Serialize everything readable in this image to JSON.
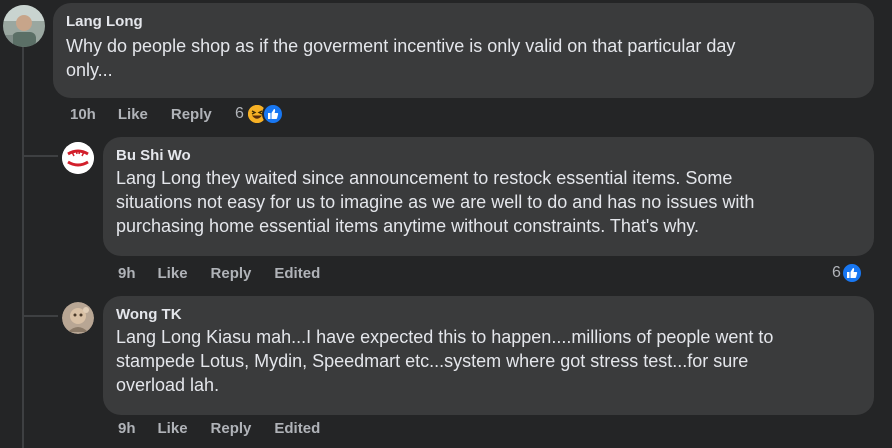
{
  "comments": [
    {
      "author": "Lang Long",
      "text_lines": [
        "Why do people shop as if the goverment incentive is only valid on that particular day",
        "only..."
      ],
      "time": "10h",
      "like_label": "Like",
      "reply_label": "Reply",
      "reaction_count": "6",
      "reactions": [
        "haha-icon",
        "like-icon"
      ]
    },
    {
      "author": "Bu Shi Wo",
      "text_lines": [
        "Lang Long they waited since announcement to restock essential items. Some",
        "situations not easy for us to imagine as we are well to do and has no issues with",
        "purchasing home essential items anytime without constraints. That's why."
      ],
      "time": "9h",
      "like_label": "Like",
      "reply_label": "Reply",
      "edited_label": "Edited",
      "reaction_count": "6",
      "reactions": [
        "like-icon"
      ]
    },
    {
      "author": "Wong TK",
      "text_lines": [
        "Lang Long Kiasu mah...I have expected this to happen....millions of people went to",
        "stampede Lotus, Mydin, Speedmart etc...system where got stress test...for sure",
        "overload lah."
      ],
      "time": "9h",
      "like_label": "Like",
      "reply_label": "Reply",
      "edited_label": "Edited"
    }
  ],
  "colors": {
    "background": "#242526",
    "bubble": "#3a3b3c",
    "text": "#e4e6eb",
    "secondary": "#b0b3b8",
    "like_blue": "#1877f2",
    "haha_yellow": "#f7b125"
  }
}
